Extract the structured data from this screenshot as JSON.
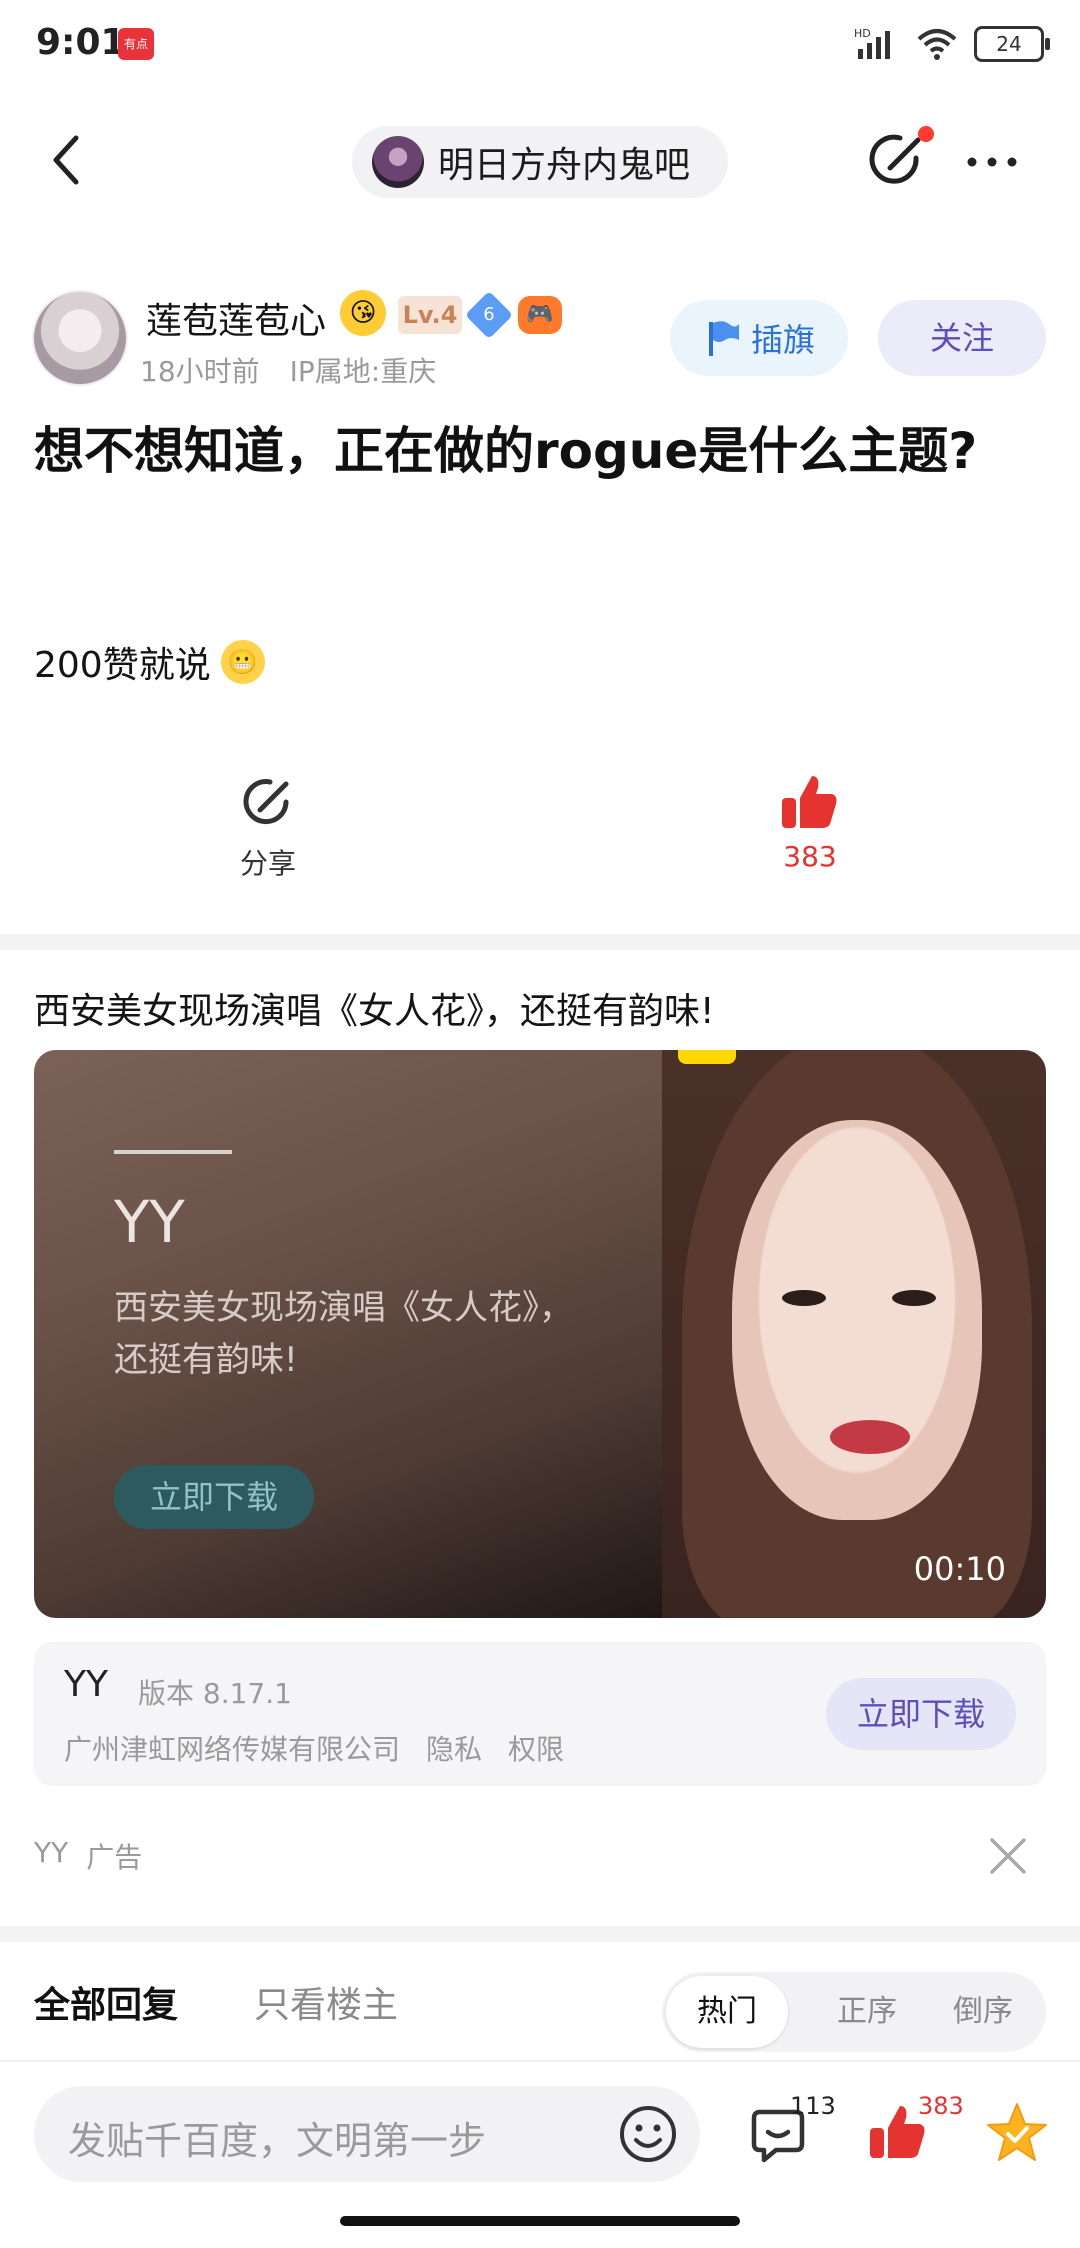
{
  "status": {
    "time": "9:01",
    "app_badge": "有点",
    "network": "HD",
    "battery": "24"
  },
  "nav": {
    "forum_name": "明日方舟内鬼吧"
  },
  "author": {
    "name": "莲苞莲苞心",
    "level": "Lv.4",
    "diamond_level": "6",
    "time_ago": "18小时前",
    "ip_location": "IP属地:重庆",
    "flag_label": "插旗",
    "follow_label": "关注"
  },
  "post": {
    "title": "想不想知道，正在做的rogue是什么主题?",
    "body": "200赞就说"
  },
  "actions": {
    "share_label": "分享",
    "like_count": "383"
  },
  "ad": {
    "title": "西安美女现场演唱《女人花》，还挺有韵味!",
    "media_brand": "YY",
    "media_desc": "西安美女现场演唱《女人花》，还挺有韵味!",
    "media_cta": "立即下载",
    "duration": "00:10",
    "app_name": "YY",
    "app_version": "版本 8.17.1",
    "company": "广州津虹网络传媒有限公司",
    "privacy": "隐私",
    "permissions": "权限",
    "download_label": "立即下载",
    "source": "YY",
    "ad_label": "广告"
  },
  "replies": {
    "tab_all": "全部回复",
    "tab_owner": "只看楼主",
    "sort_hot": "热门",
    "sort_asc": "正序",
    "sort_desc": "倒序"
  },
  "bottom_bar": {
    "placeholder": "发贴千百度，文明第一步",
    "comment_count": "113",
    "like_count": "383"
  },
  "colors": {
    "accent_red": "#e5332f",
    "accent_purple": "#5b4fb8",
    "accent_blue": "#2b6fd8"
  }
}
